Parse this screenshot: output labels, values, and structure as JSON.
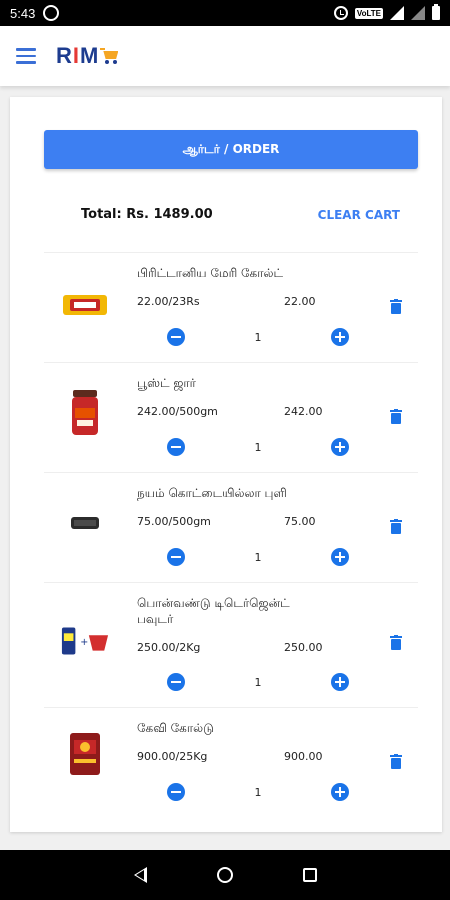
{
  "status_bar": {
    "time": "5:43",
    "network_badge": "VoLTE",
    "icons": [
      "whatsapp-icon",
      "alarm-icon",
      "signal-icon",
      "battery-icon"
    ]
  },
  "app_bar": {
    "logo_part1": "R",
    "logo_part2": "I",
    "logo_part3": "M",
    "icons": [
      "hamburger-menu-icon",
      "cart-logo-icon"
    ]
  },
  "cart": {
    "order_button_label": "ஆர்டர் / ORDER",
    "total_label": "Total: Rs. 1489.00",
    "clear_cart_label": "CLEAR CART",
    "items": [
      {
        "name": "பிரிட்டானிய மேரி கோல்ட்",
        "price": "22.00/23Rs",
        "subtotal": "22.00",
        "qty": "1"
      },
      {
        "name": "பூஸ்ட் ஜார்",
        "price": "242.00/500gm",
        "subtotal": "242.00",
        "qty": "1"
      },
      {
        "name": "நயம் கொட்டையில்லா புளி",
        "price": "75.00/500gm",
        "subtotal": "75.00",
        "qty": "1"
      },
      {
        "name": "பொன்வண்டு டிடெர்ஜென்ட் பவுடர்",
        "price": "250.00/2Kg",
        "subtotal": "250.00",
        "qty": "1"
      },
      {
        "name": "கேவி கோல்டு",
        "price": "900.00/25Kg",
        "subtotal": "900.00",
        "qty": "1"
      }
    ]
  },
  "colors": {
    "accent": "#3d7ff2",
    "icon_blue": "#1a73e8",
    "logo_navy": "#1d3c8f",
    "logo_red": "#e53935",
    "logo_orange": "#f5a623"
  }
}
